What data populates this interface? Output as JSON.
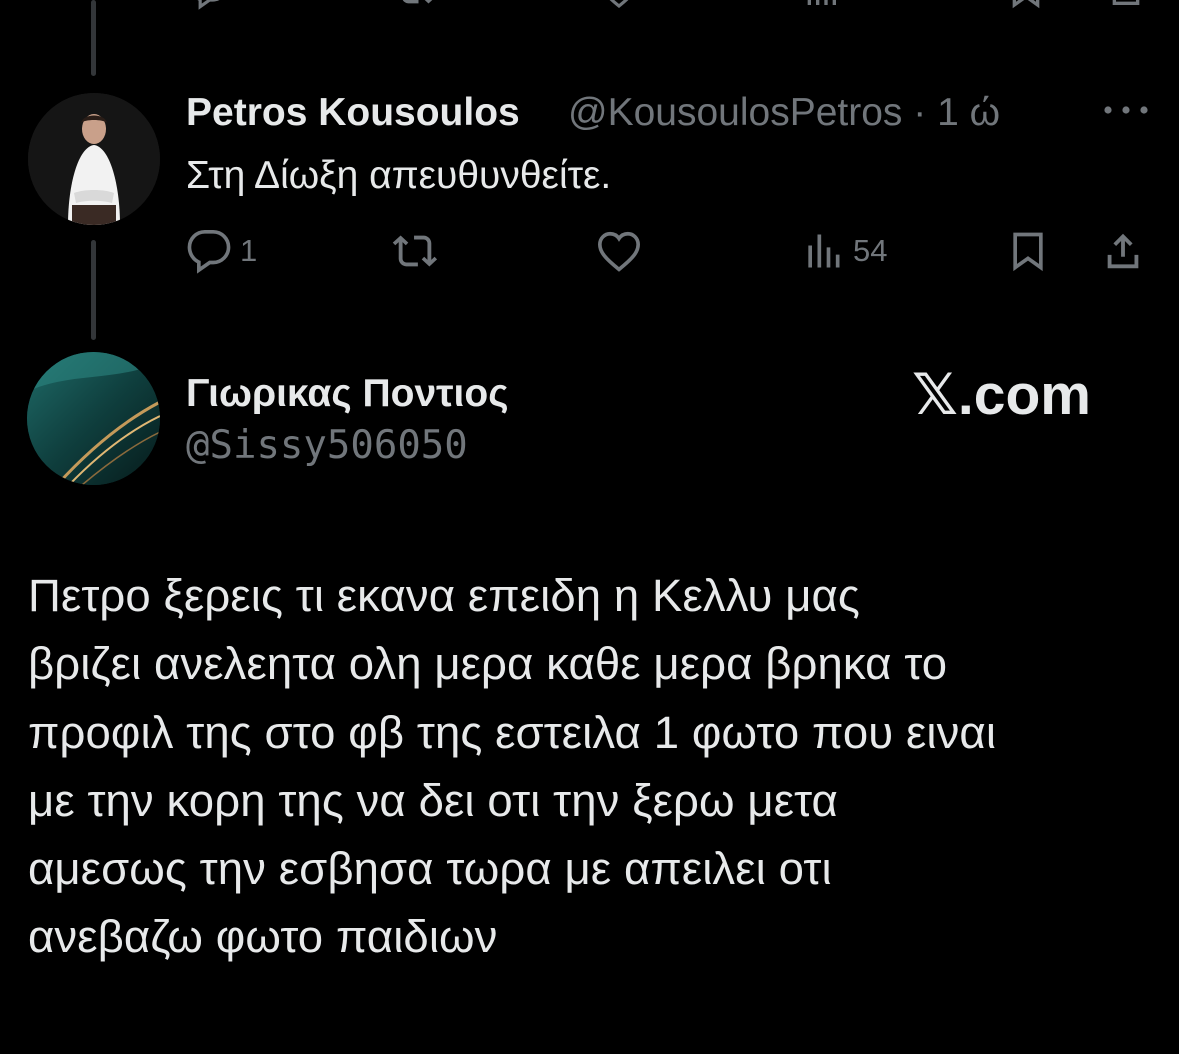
{
  "colors": {
    "background": "#000000",
    "text_primary": "#e7e9ea",
    "text_secondary": "#71767b",
    "thread_line": "#333639"
  },
  "reply": {
    "author_name": "Petros Kousoulos",
    "handle": "@KousoulosPetros",
    "separator": "·",
    "time": "1 ώ",
    "text": "Στη Δίωξη απευθυνθείτε.",
    "more_icon": "more-horizontal-icon",
    "actions": {
      "reply_count": "1",
      "retweet_count": "",
      "like_count": "",
      "views_count": "54"
    }
  },
  "quoted_tweet": {
    "author_name": "Γιωρικας Ποντιος",
    "handle": "@Sissy506050",
    "watermark": "𝕏.com",
    "body": "Πετρο ξερεις τι εκανα επειδη η Κελλυ μας\nβριζει ανελεητα ολη μερα καθε μερα βρηκα το\nπροφιλ της στο φβ της εστειλα 1 φωτο που ειναι\nμε την κορη της να δει οτι την ξερω μετα\nαμεσως την εσβησα τωρα με απειλει οτι\nανεβαζω φωτο παιδιων"
  }
}
